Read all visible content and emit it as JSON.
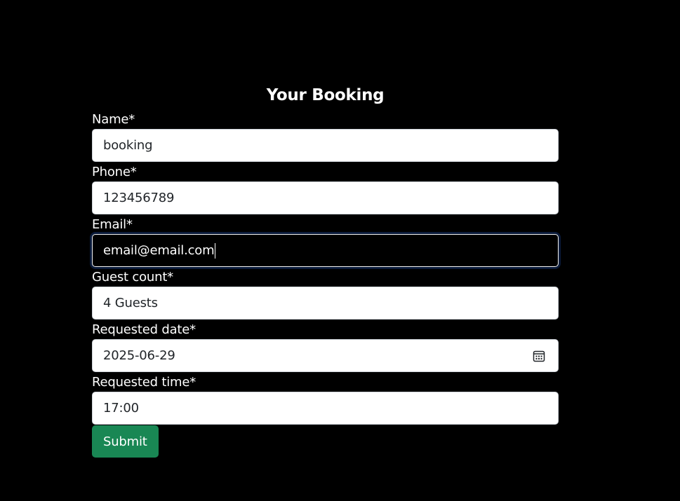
{
  "form": {
    "title": "Your Booking",
    "fields": {
      "name": {
        "label": "Name*",
        "value": "booking"
      },
      "phone": {
        "label": "Phone*",
        "value": "123456789"
      },
      "email": {
        "label": "Email*",
        "value": "email@email.com"
      },
      "guests": {
        "label": "Guest count*",
        "value": "4 Guests"
      },
      "date": {
        "label": "Requested date*",
        "value": "2025-06-29",
        "icon": "calendar-icon"
      },
      "time": {
        "label": "Requested time*",
        "value": "17:00"
      }
    },
    "submit_label": "Submit"
  },
  "colors": {
    "background": "#000000",
    "submit": "#198754",
    "focus_ring": "#0a1a3a"
  }
}
